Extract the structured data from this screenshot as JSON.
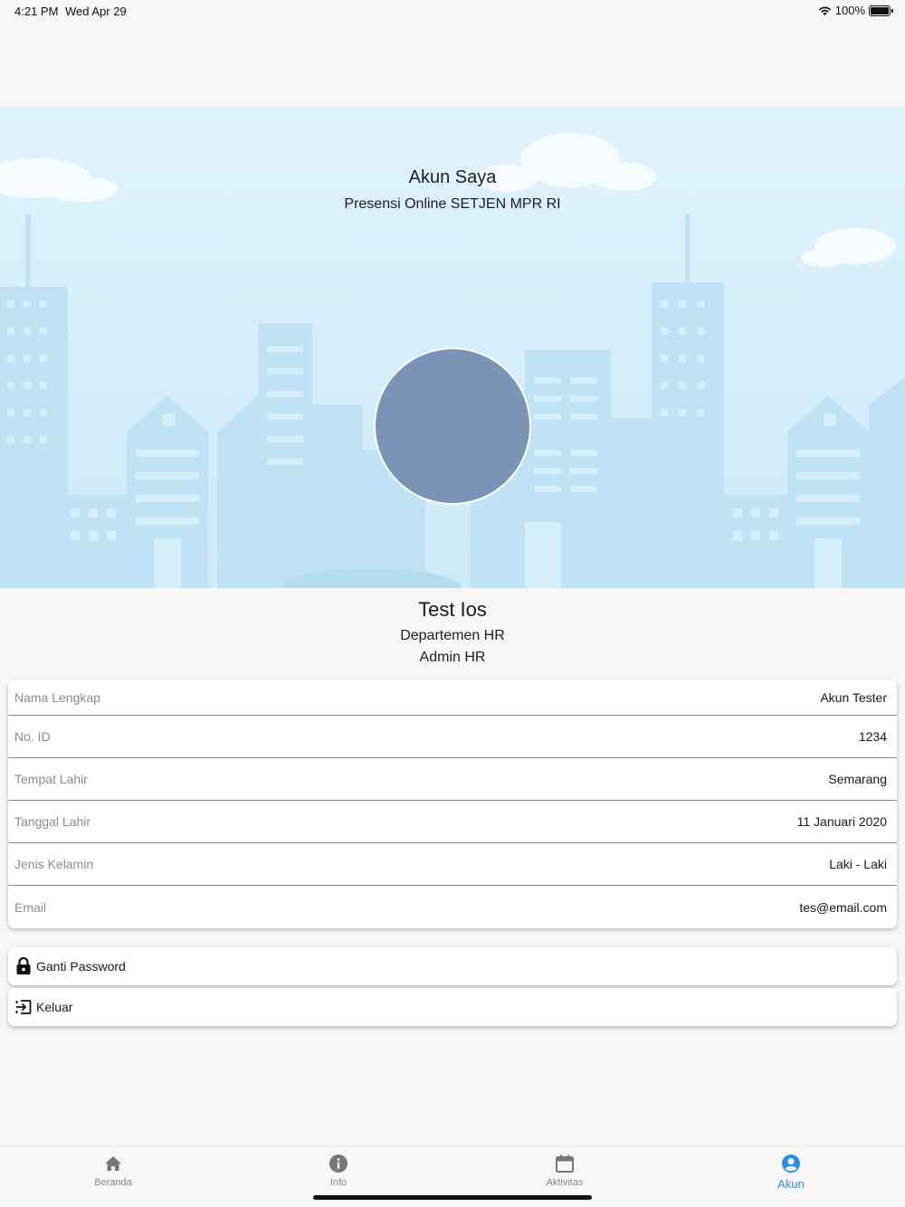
{
  "status_bar": {
    "time": "4:21 PM",
    "date": "Wed Apr 29",
    "battery": "100%"
  },
  "header": {
    "title": "Akun Saya",
    "subtitle": "Presensi Online SETJEN MPR RI"
  },
  "profile": {
    "name": "Test Ios",
    "department": "Departemen HR",
    "role": "Admin HR"
  },
  "info": [
    {
      "label": "Nama Lengkap",
      "value": "Akun Tester"
    },
    {
      "label": "No. ID",
      "value": "1234"
    },
    {
      "label": "Tempat Lahir",
      "value": "Semarang"
    },
    {
      "label": "Tanggal Lahir",
      "value": "11 Januari 2020"
    },
    {
      "label": "Jenis Kelamin",
      "value": "Laki - Laki"
    },
    {
      "label": "Email",
      "value": "tes@email.com"
    }
  ],
  "actions": {
    "change_password": {
      "label": "Ganti Password",
      "icon": "lock-icon"
    },
    "logout": {
      "label": "Keluar",
      "icon": "logout-icon"
    }
  },
  "nav": [
    {
      "label": "Beranda",
      "icon": "home-icon",
      "active": false
    },
    {
      "label": "Info",
      "icon": "info-icon",
      "active": false
    },
    {
      "label": "Aktivitas",
      "icon": "calendar-icon",
      "active": false
    },
    {
      "label": "Akun",
      "icon": "account-icon",
      "active": true
    }
  ],
  "colors": {
    "accent": "#2a8ee8",
    "avatar": "#7b93b5",
    "hero_bg": "#d9f0fb"
  }
}
